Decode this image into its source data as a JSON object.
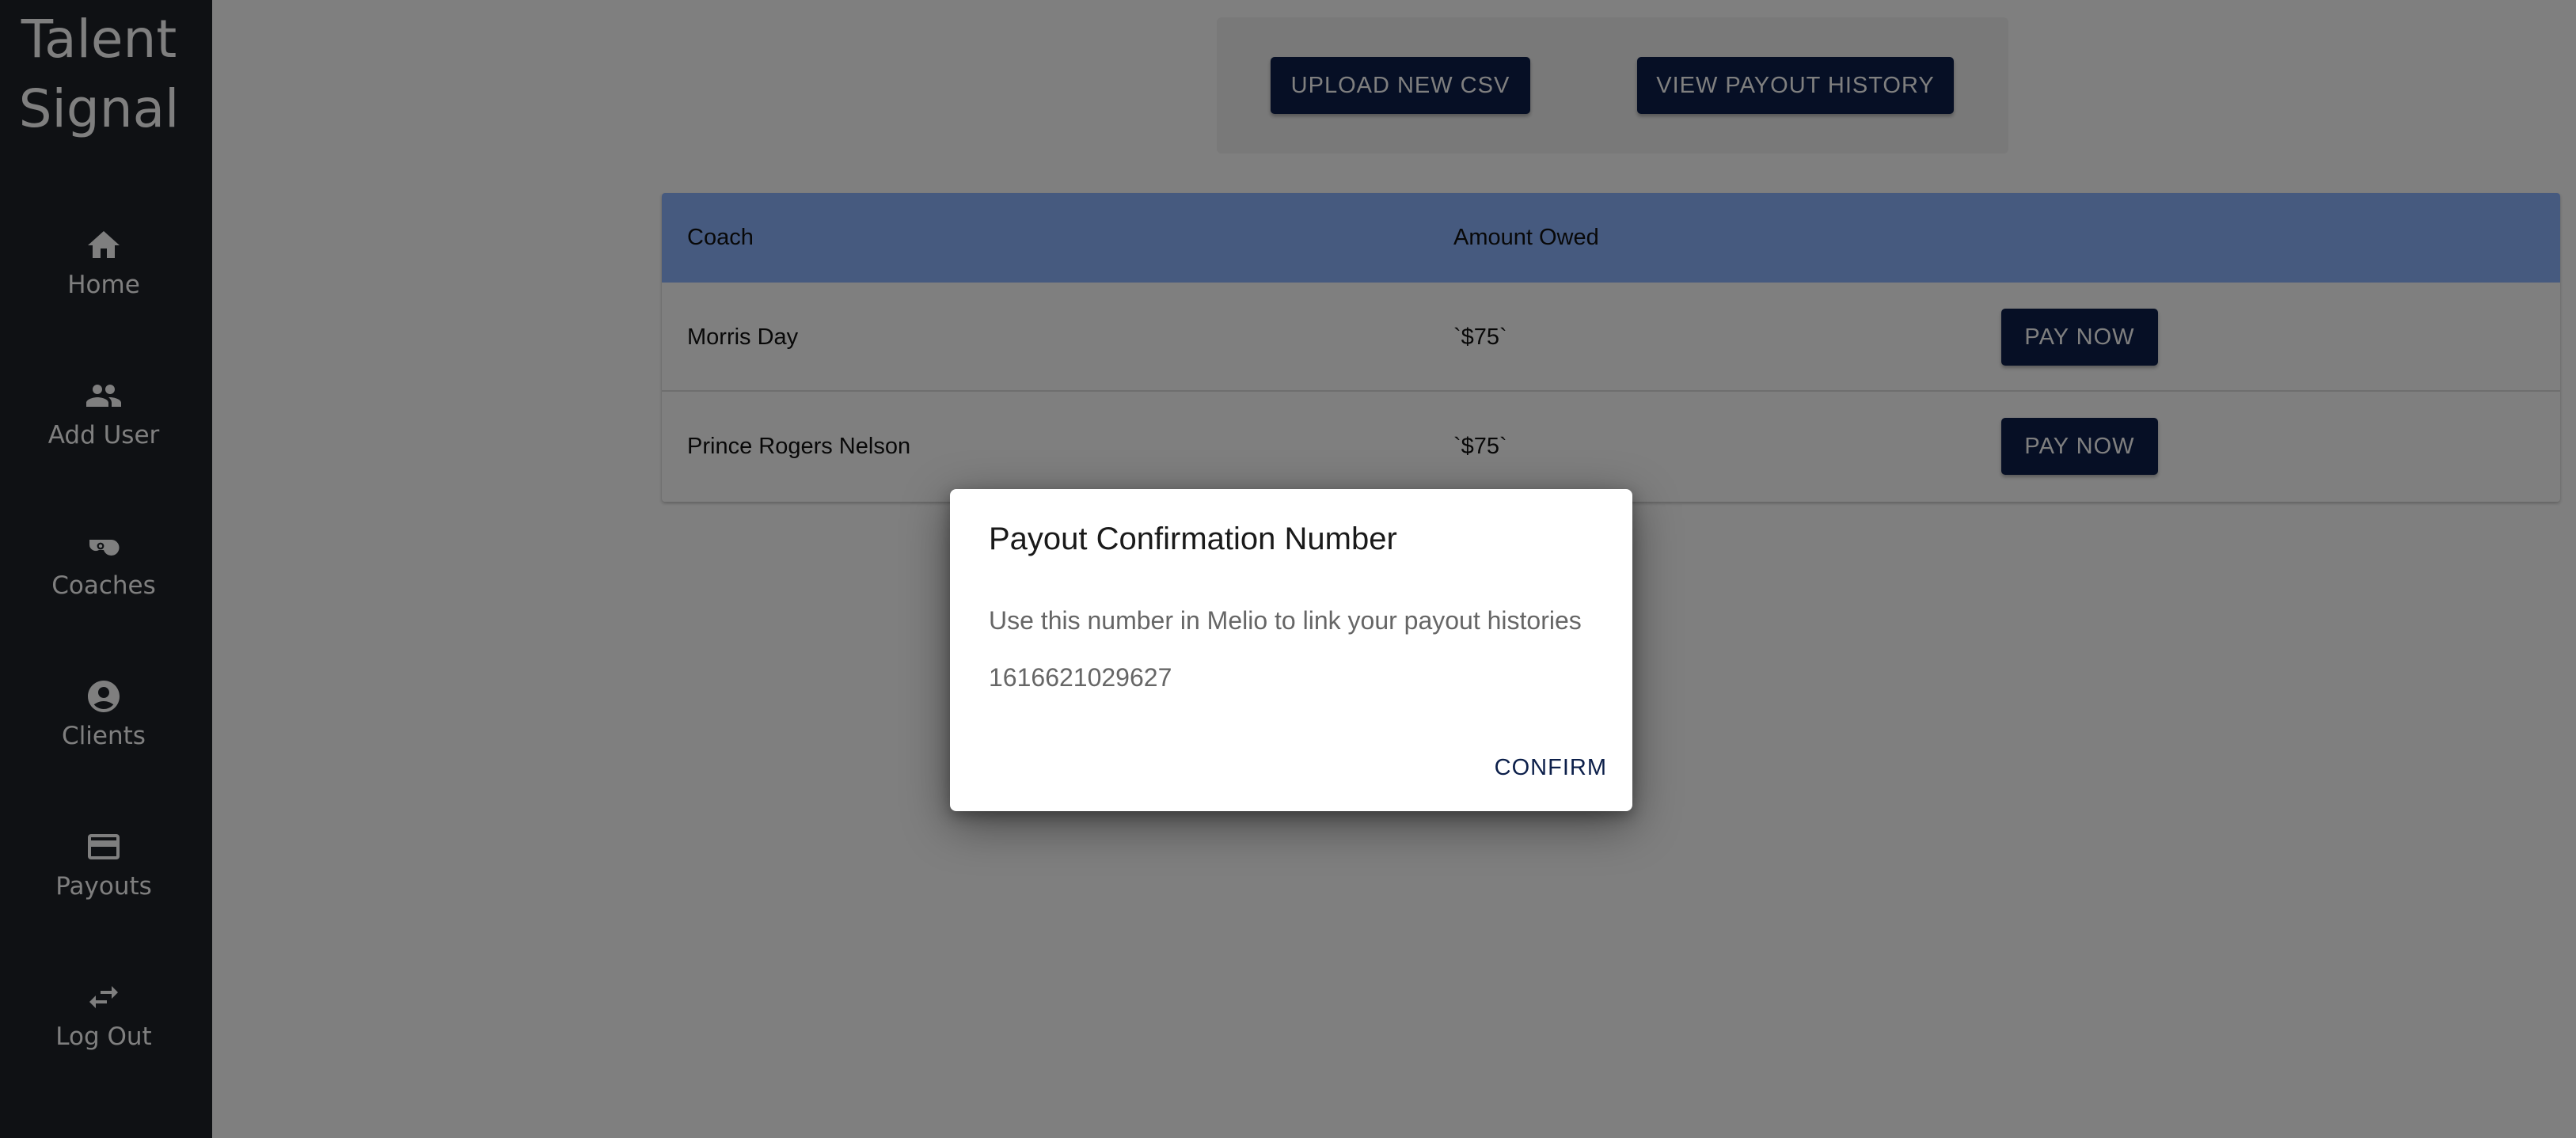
{
  "app": {
    "brand_line1": "Talent",
    "brand_line2": "Signal"
  },
  "sidebar": {
    "items": [
      {
        "label": "Home",
        "icon": "home-icon"
      },
      {
        "label": "Add User",
        "icon": "people-icon"
      },
      {
        "label": "Coaches",
        "icon": "whistle-icon"
      },
      {
        "label": "Clients",
        "icon": "account-circle-icon"
      },
      {
        "label": "Payouts",
        "icon": "credit-card-icon"
      },
      {
        "label": "Log Out",
        "icon": "swap-arrows-icon"
      }
    ]
  },
  "toolbar": {
    "upload_label": "UPLOAD NEW CSV",
    "history_label": "VIEW PAYOUT HISTORY"
  },
  "table": {
    "headers": [
      "Coach",
      "Amount Owed",
      ""
    ],
    "rows": [
      {
        "coach": "Morris Day",
        "amount": "`$75`",
        "action": "PAY NOW"
      },
      {
        "coach": "Prince Rogers Nelson",
        "amount": "`$75`",
        "action": "PAY NOW"
      }
    ]
  },
  "dialog": {
    "title": "Payout Confirmation Number",
    "message": "Use this number in Melio to link your payout histories",
    "number": "1616621029627",
    "confirm_label": "CONFIRM"
  },
  "colors": {
    "sidebar_bg": "#1f2329",
    "accent_dark": "#0c1f4a",
    "table_header": "#8cb4ff",
    "overlay": "rgba(0,0,0,0.5)"
  }
}
